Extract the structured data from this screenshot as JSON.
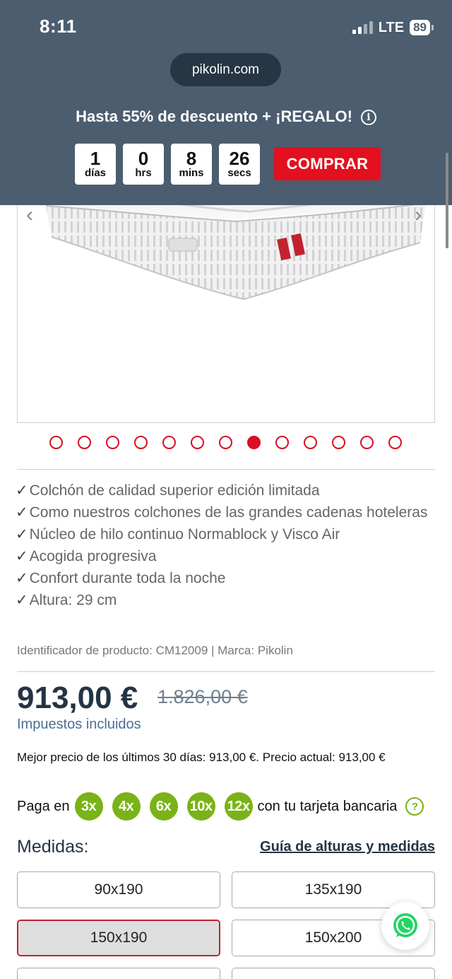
{
  "status_bar": {
    "time": "8:11",
    "network": "LTE",
    "battery": "89"
  },
  "browser": {
    "url": "pikolin.com"
  },
  "promo": {
    "text": "Hasta 55% de descuento + ¡REGALO!",
    "countdown": [
      {
        "value": "1",
        "unit": "días"
      },
      {
        "value": "0",
        "unit": "hrs"
      },
      {
        "value": "8",
        "unit": "mins"
      },
      {
        "value": "26",
        "unit": "secs"
      }
    ],
    "buy_label": "COMPRAR",
    "buy_color": "#e3101f",
    "header_color": "#4b5d6f"
  },
  "gallery": {
    "total_images": 13,
    "active_index": 7,
    "prev_icon": "chevron-left-icon",
    "next_icon": "chevron-right-icon"
  },
  "features": [
    "Colchón de calidad superior edición limitada",
    "Como nuestros colchones de las grandes cadenas hoteleras",
    "Núcleo de hilo continuo Normablock y Visco Air",
    "Acogida progresiva",
    "Confort durante toda la noche",
    "Altura: 29 cm"
  ],
  "check_mark": "✓",
  "product_id_line": "Identificador de producto: CM12009 | Marca: Pikolin",
  "pricing": {
    "price": "913,00 €",
    "old_price": "1.826,00 €",
    "taxes": "Impuestos incluidos",
    "best_price_note": "Mejor precio de los últimos 30 días: 913,00 €. Precio actual: 913,00 €"
  },
  "financing": {
    "prefix": "Paga en",
    "options": [
      "3x",
      "4x",
      "6x",
      "10x",
      "12x"
    ],
    "suffix": "con tu tarjeta bancaria",
    "help": "?",
    "accent": "#79b317"
  },
  "sizes": {
    "title": "Medidas:",
    "guide_link": "Guía de alturas y medidas",
    "options": [
      "90x190",
      "135x190",
      "150x190",
      "150x200"
    ],
    "selected": "150x190"
  }
}
